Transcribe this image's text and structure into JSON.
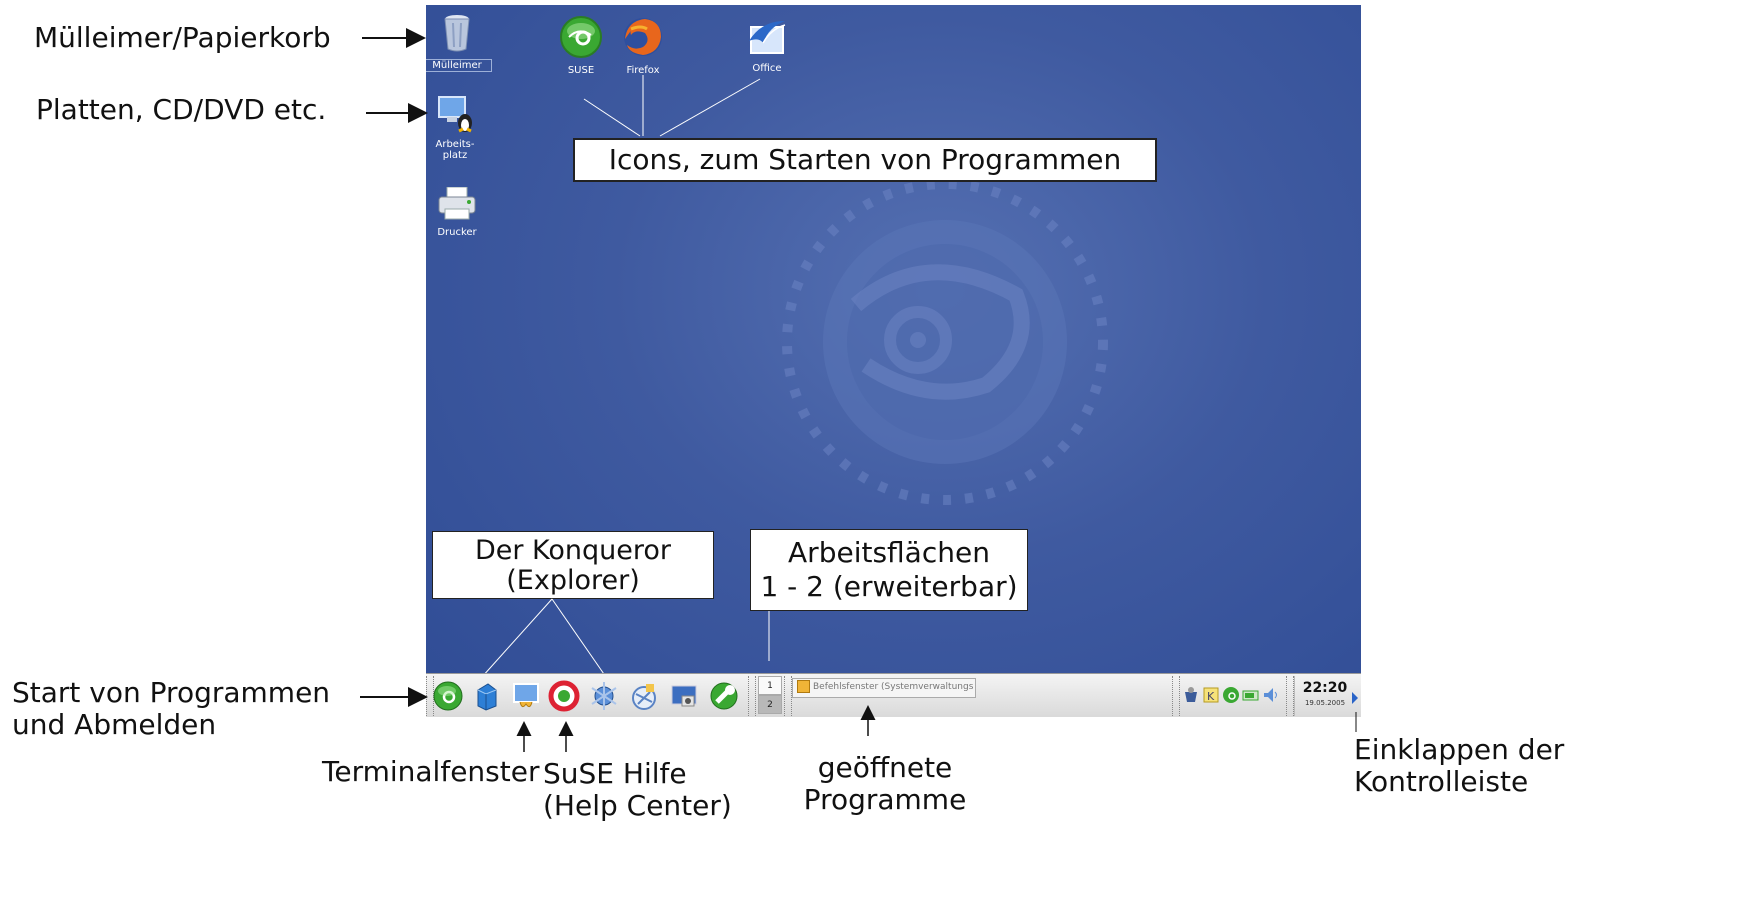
{
  "annotations": {
    "trash": "Mülleimer/Papierkorb",
    "drives": "Platten, CD/DVD etc.",
    "start_line1": "Start von Programmen",
    "start_line2": "und Abmelden",
    "terminal": "Terminalfenster",
    "help_line1": "SuSE Hilfe",
    "help_line2": "(Help Center)",
    "programs_line1": "geöffnete",
    "programs_line2": "Programme",
    "collapse_line1": "Einklappen der",
    "collapse_line2": "Kontrolleiste"
  },
  "callouts": {
    "icons": "Icons, zum Starten von Programmen",
    "konqueror_line1": "Der Konqueror",
    "konqueror_line2": "(Explorer)",
    "workspaces_line1": "Arbeitsflächen",
    "workspaces_line2": "1 - 2 (erweiterbar)"
  },
  "desktop": {
    "icons": [
      {
        "label": "Mülleimer",
        "icon": "trash-icon"
      },
      {
        "label": "Arbeits-",
        "label2": "platz",
        "icon": "computer-icon"
      },
      {
        "label": "Drucker",
        "icon": "printer-icon"
      },
      {
        "label": "SUSE",
        "icon": "suse-icon"
      },
      {
        "label": "Firefox",
        "icon": "firefox-icon"
      },
      {
        "label": "Office",
        "icon": "office-icon"
      }
    ]
  },
  "panel": {
    "launchers": [
      "suse-menu-icon",
      "home-icon",
      "terminal-icon",
      "help-icon",
      "network-icon",
      "konqueror-icon",
      "desktop-icon",
      "settings-icon"
    ],
    "pager": [
      "1",
      "2"
    ],
    "task": "Befehlsfenster (Systemverwaltungs",
    "tray": [
      "klipper-icon",
      "korganizer-icon",
      "suse-updater-icon",
      "battery-icon",
      "volume-icon"
    ],
    "clock_time": "22:20",
    "clock_date": "19.05.2005"
  },
  "colors": {
    "desktop": "#3f5aa0",
    "panel": "#e6e6e6",
    "suse_green": "#3aa832"
  }
}
